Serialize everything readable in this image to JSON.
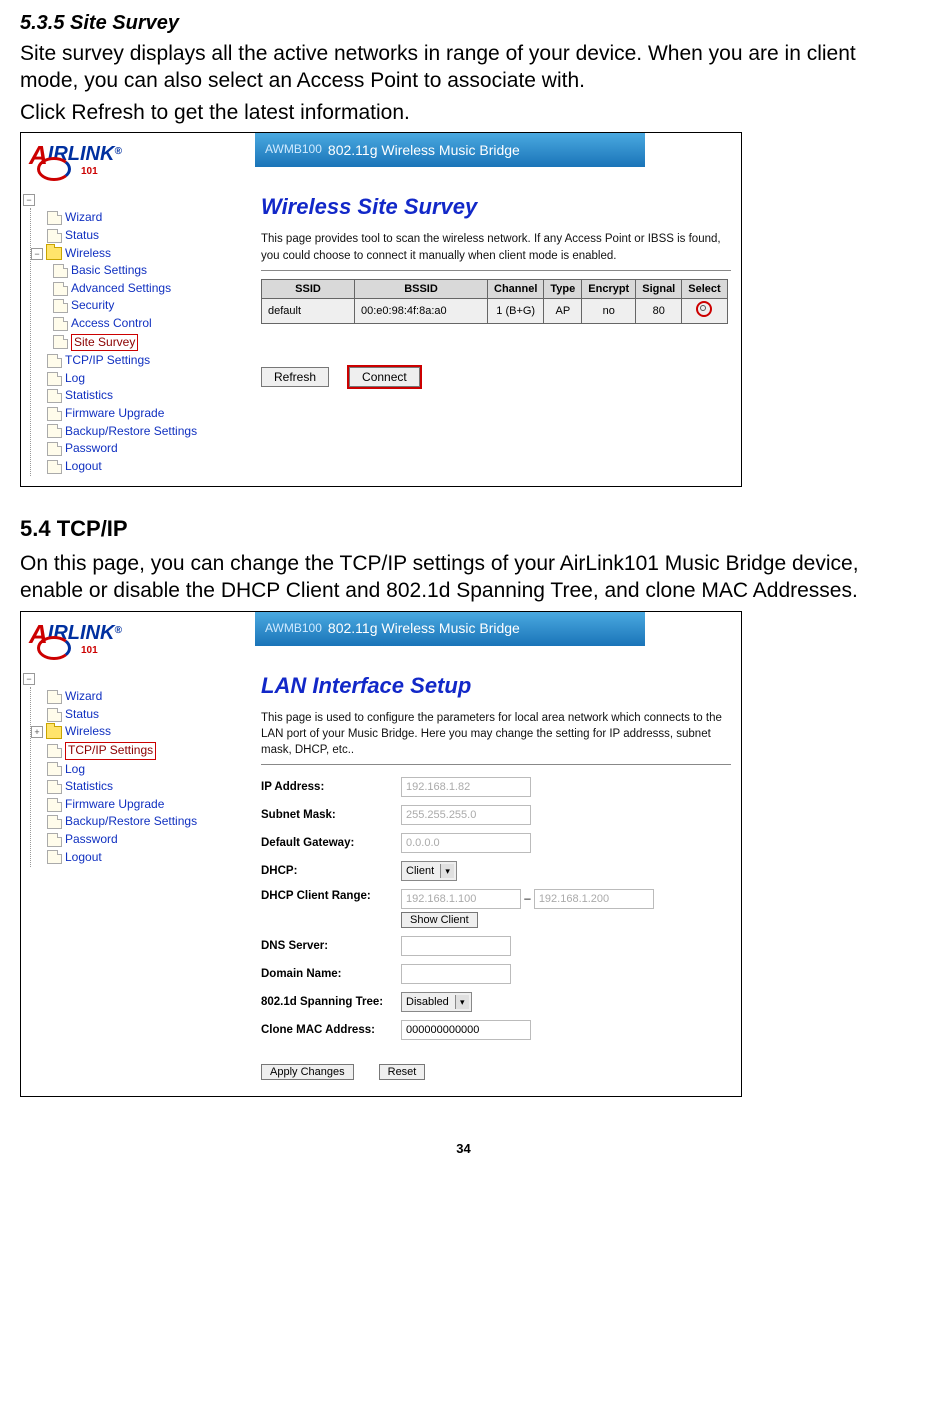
{
  "section1": {
    "heading": "5.3.5 Site Survey",
    "p1": "Site survey displays all the active networks in range of your device. When you are in client mode, you can also select an Access Point to associate with.",
    "p2": "Click Refresh to get the latest information."
  },
  "shot1": {
    "logo": {
      "a": "A",
      "rest": "IRLINK",
      "reg": "®",
      "sub": "101"
    },
    "banner": {
      "model": "AWMB100",
      "title": "802.11g Wireless Music Bridge"
    },
    "nav": {
      "wizard": "Wizard",
      "status": "Status",
      "wireless": "Wireless",
      "basic": "Basic Settings",
      "advanced": "Advanced Settings",
      "security": "Security",
      "access": "Access Control",
      "sitesurvey": "Site Survey",
      "tcpip": "TCP/IP Settings",
      "log": "Log",
      "stats": "Statistics",
      "fw": "Firmware Upgrade",
      "backup": "Backup/Restore Settings",
      "password": "Password",
      "logout": "Logout"
    },
    "page": {
      "title": "Wireless Site Survey",
      "desc": "This page provides tool to scan the wireless network. If any Access Point or IBSS is found, you could choose to connect it manually when client mode is enabled.",
      "th": {
        "ssid": "SSID",
        "bssid": "BSSID",
        "channel": "Channel",
        "type": "Type",
        "encrypt": "Encrypt",
        "signal": "Signal",
        "select": "Select"
      },
      "row": {
        "ssid": "default",
        "bssid": "00:e0:98:4f:8a:a0",
        "channel": "1 (B+G)",
        "type": "AP",
        "encrypt": "no",
        "signal": "80"
      },
      "btn_refresh": "Refresh",
      "btn_connect": "Connect"
    }
  },
  "section2": {
    "heading": "5.4 TCP/IP",
    "p1": "On this page, you can change the TCP/IP settings of your AirLink101 Music Bridge device, enable or disable the DHCP Client and 802.1d Spanning Tree, and clone MAC Addresses."
  },
  "shot2": {
    "banner": {
      "model": "AWMB100",
      "title": "802.11g Wireless Music Bridge"
    },
    "nav": {
      "wizard": "Wizard",
      "status": "Status",
      "wireless": "Wireless",
      "tcpip": "TCP/IP Settings",
      "log": "Log",
      "stats": "Statistics",
      "fw": "Firmware Upgrade",
      "backup": "Backup/Restore Settings",
      "password": "Password",
      "logout": "Logout"
    },
    "page": {
      "title": "LAN Interface Setup",
      "desc": "This page is used to configure the parameters for local area network which connects to the LAN port of your Music Bridge. Here you may change the setting for IP addresss, subnet mask, DHCP, etc..",
      "labels": {
        "ip": "IP Address:",
        "subnet": "Subnet Mask:",
        "gw": "Default Gateway:",
        "dhcp": "DHCP:",
        "range": "DHCP Client Range:",
        "dns": "DNS Server:",
        "domain": "Domain Name:",
        "span": "802.1d Spanning Tree:",
        "clone": "Clone MAC Address:"
      },
      "values": {
        "ip": "192.168.1.82",
        "subnet": "255.255.255.0",
        "gw": "0.0.0.0",
        "dhcp": "Client",
        "range_from": "192.168.1.100",
        "range_dash": "–",
        "range_to": "192.168.1.200",
        "show_client": "Show Client",
        "span": "Disabled",
        "clone": "000000000000"
      },
      "btn_apply": "Apply Changes",
      "btn_reset": "Reset"
    }
  },
  "pagenum": "34"
}
